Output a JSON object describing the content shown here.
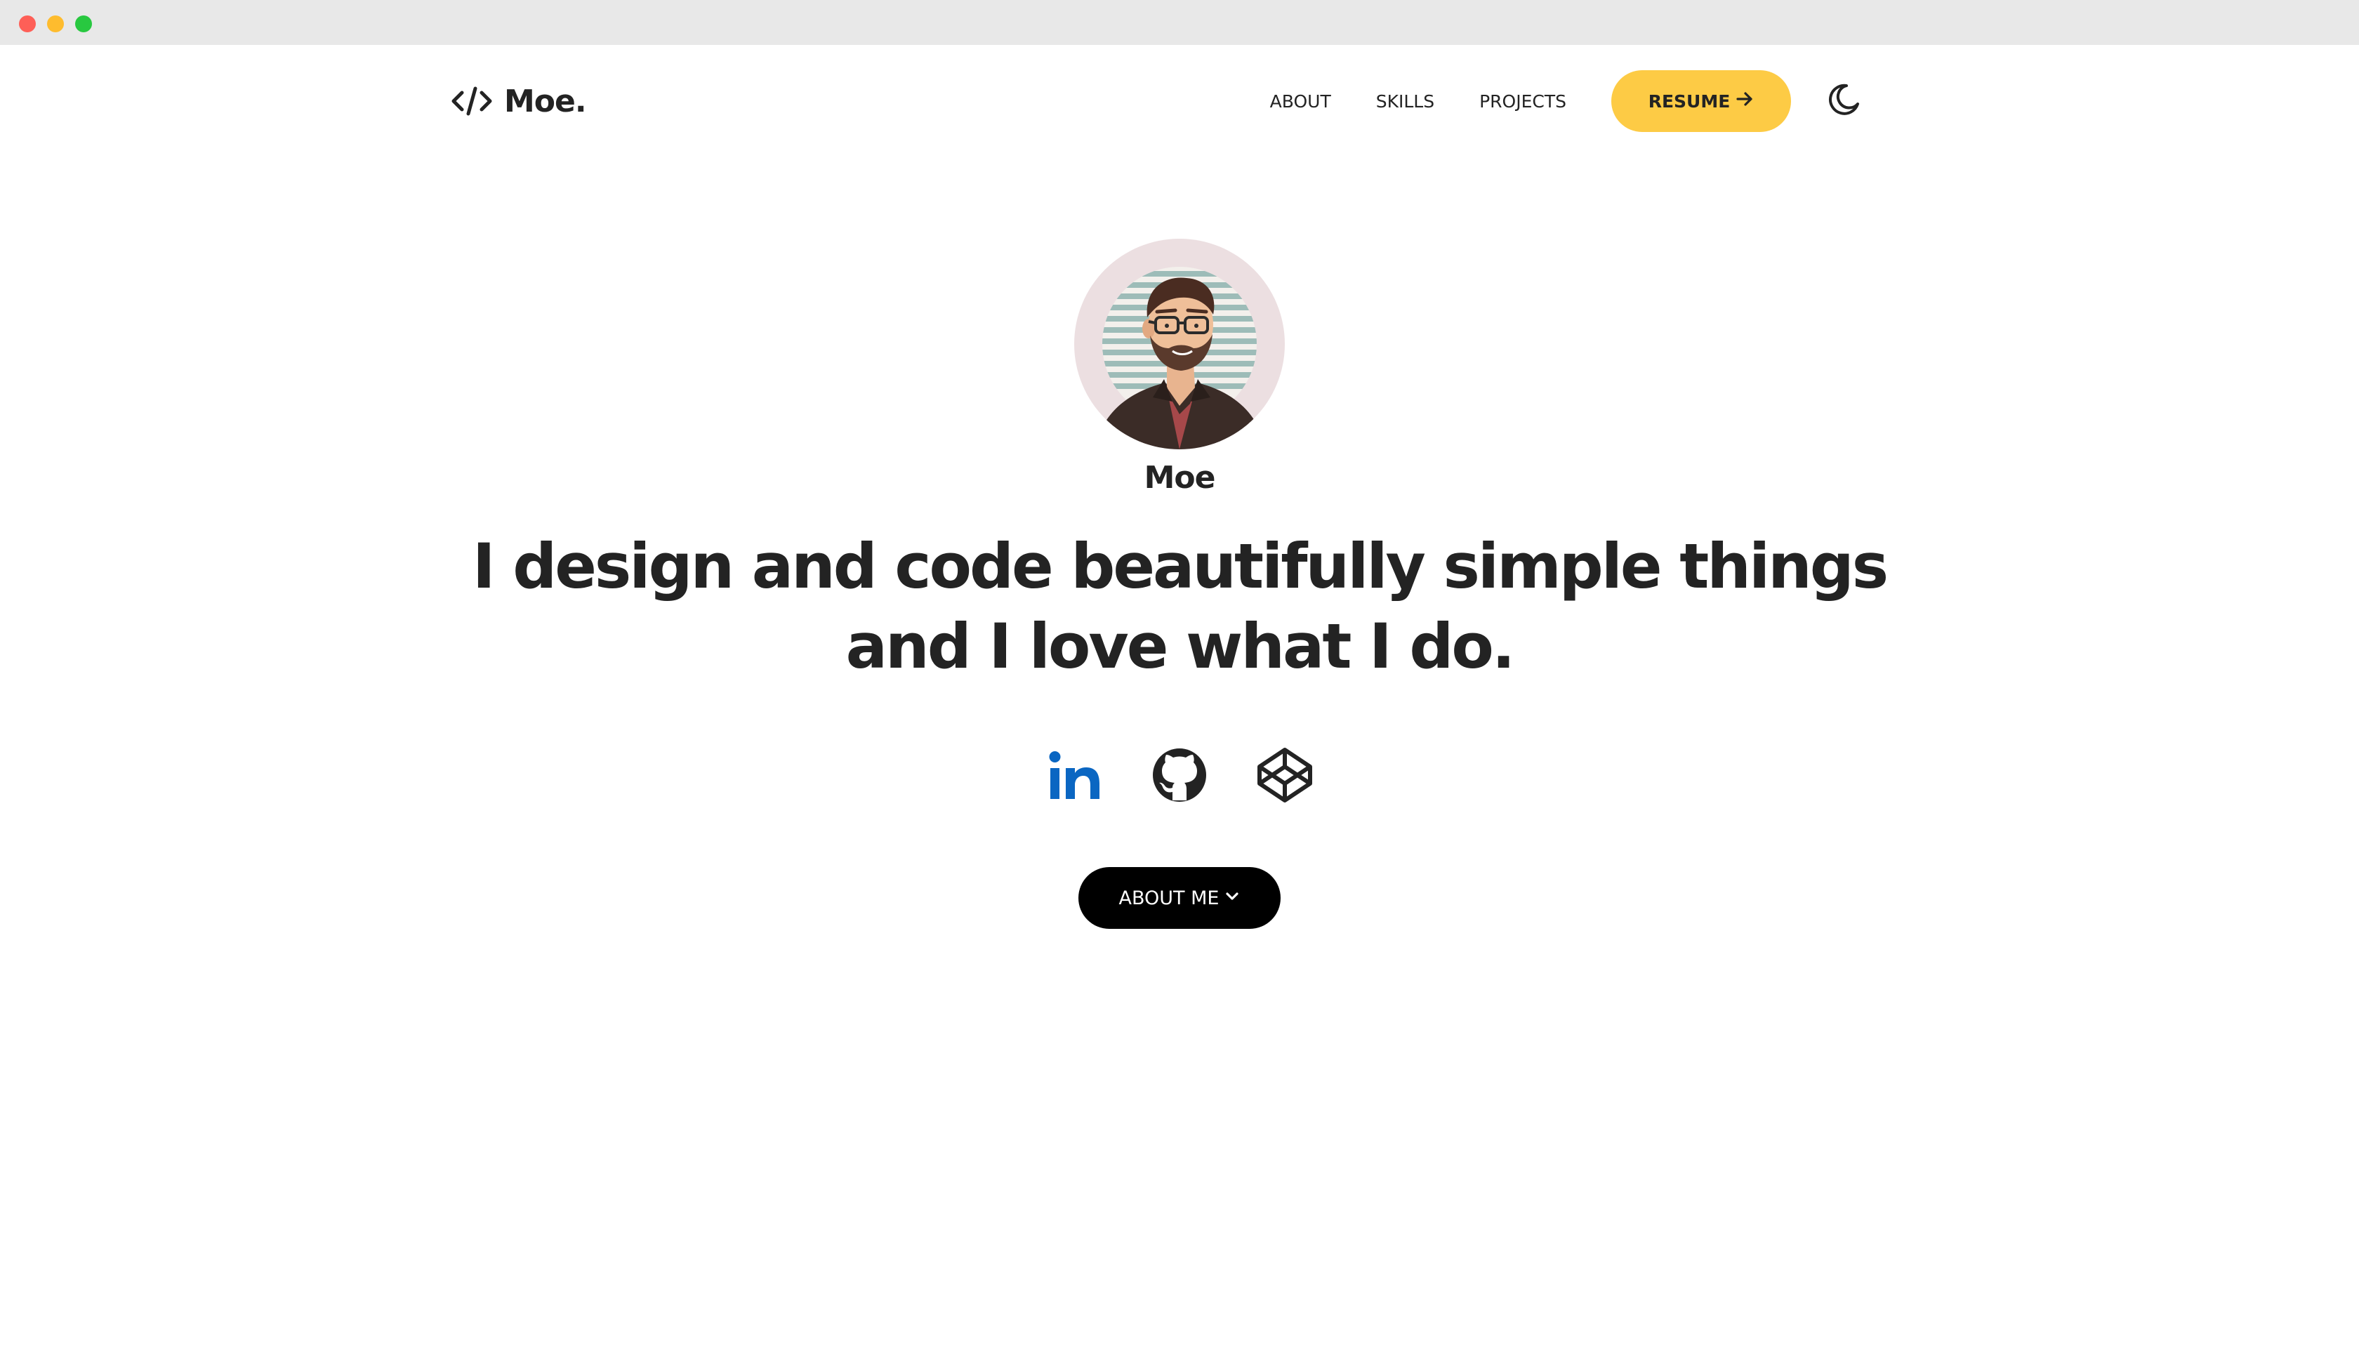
{
  "window": {
    "controls": [
      "close",
      "minimize",
      "maximize"
    ]
  },
  "nav": {
    "logo_text": "Moe.",
    "logo_icon": "code-brackets-icon",
    "links": [
      {
        "label": "ABOUT"
      },
      {
        "label": "SKILLS"
      },
      {
        "label": "PROJECTS"
      }
    ],
    "resume_label": "RESUME",
    "resume_icon": "arrow-right-icon",
    "theme_icon": "moon-icon"
  },
  "hero": {
    "avatar_icon": "avatar-illustration",
    "name": "Moe",
    "headline_line1": "I design and code beautifully simple things",
    "headline_line2": "and I love what I do.",
    "socials": [
      {
        "name": "linkedin",
        "icon": "linkedin-icon",
        "color": "#0a66c2"
      },
      {
        "name": "github",
        "icon": "github-icon",
        "color": "#232323"
      },
      {
        "name": "codepen",
        "icon": "codepen-icon",
        "color": "#232323"
      }
    ],
    "about_button_label": "ABOUT ME",
    "about_button_icon": "chevron-down-icon"
  },
  "colors": {
    "accent": "#fdcb45",
    "text": "#232323",
    "button_dark": "#000000",
    "background": "#ffffff",
    "avatar_bg": "#ecdfe1"
  }
}
